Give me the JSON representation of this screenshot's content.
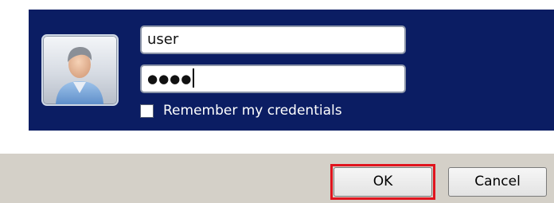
{
  "dialog": {
    "user_icon": "user-account-icon",
    "username": {
      "value": "user",
      "masked": false
    },
    "password": {
      "masked_value": "●●●●",
      "length": 4,
      "focused": true
    },
    "remember": {
      "label": "Remember my credentials",
      "checked": false
    }
  },
  "buttons": {
    "ok_label": "OK",
    "cancel_label": "Cancel"
  },
  "annotation": {
    "highlighted_button": "ok",
    "highlight_color": "#e0141e"
  },
  "colors": {
    "panel_background": "#0b1d63",
    "button_bar_background": "#d4d0c8"
  }
}
